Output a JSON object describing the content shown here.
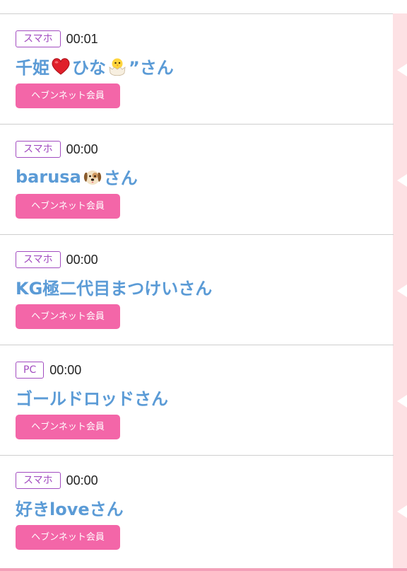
{
  "entries": [
    {
      "device": "スマホ",
      "time": "00:01",
      "name_parts": [
        "千姫",
        "ひな",
        "”さん"
      ],
      "icons": [
        "red-heart-icon",
        "hatching-chick-icon"
      ],
      "member_label": "ヘブンネット会員"
    },
    {
      "device": "スマホ",
      "time": "00:00",
      "name_parts": [
        "barusa",
        "さん"
      ],
      "icons": [
        "dog-face-icon"
      ],
      "member_label": "ヘブンネット会員"
    },
    {
      "device": "スマホ",
      "time": "00:00",
      "name": "KG極二代目まつけいさん",
      "member_label": "ヘブンネット会員"
    },
    {
      "device": "PC",
      "time": "00:00",
      "name": "ゴールドロッドさん",
      "member_label": "ヘブンネット会員"
    },
    {
      "device": "スマホ",
      "time": "00:00",
      "name": "好きloveさん",
      "member_label": "ヘブンネット会員"
    }
  ],
  "colors": {
    "badge_border": "#a24cc0",
    "name_text": "#5b9bd6",
    "member_button": "#f366a8",
    "side_strip": "#fde1e4"
  }
}
